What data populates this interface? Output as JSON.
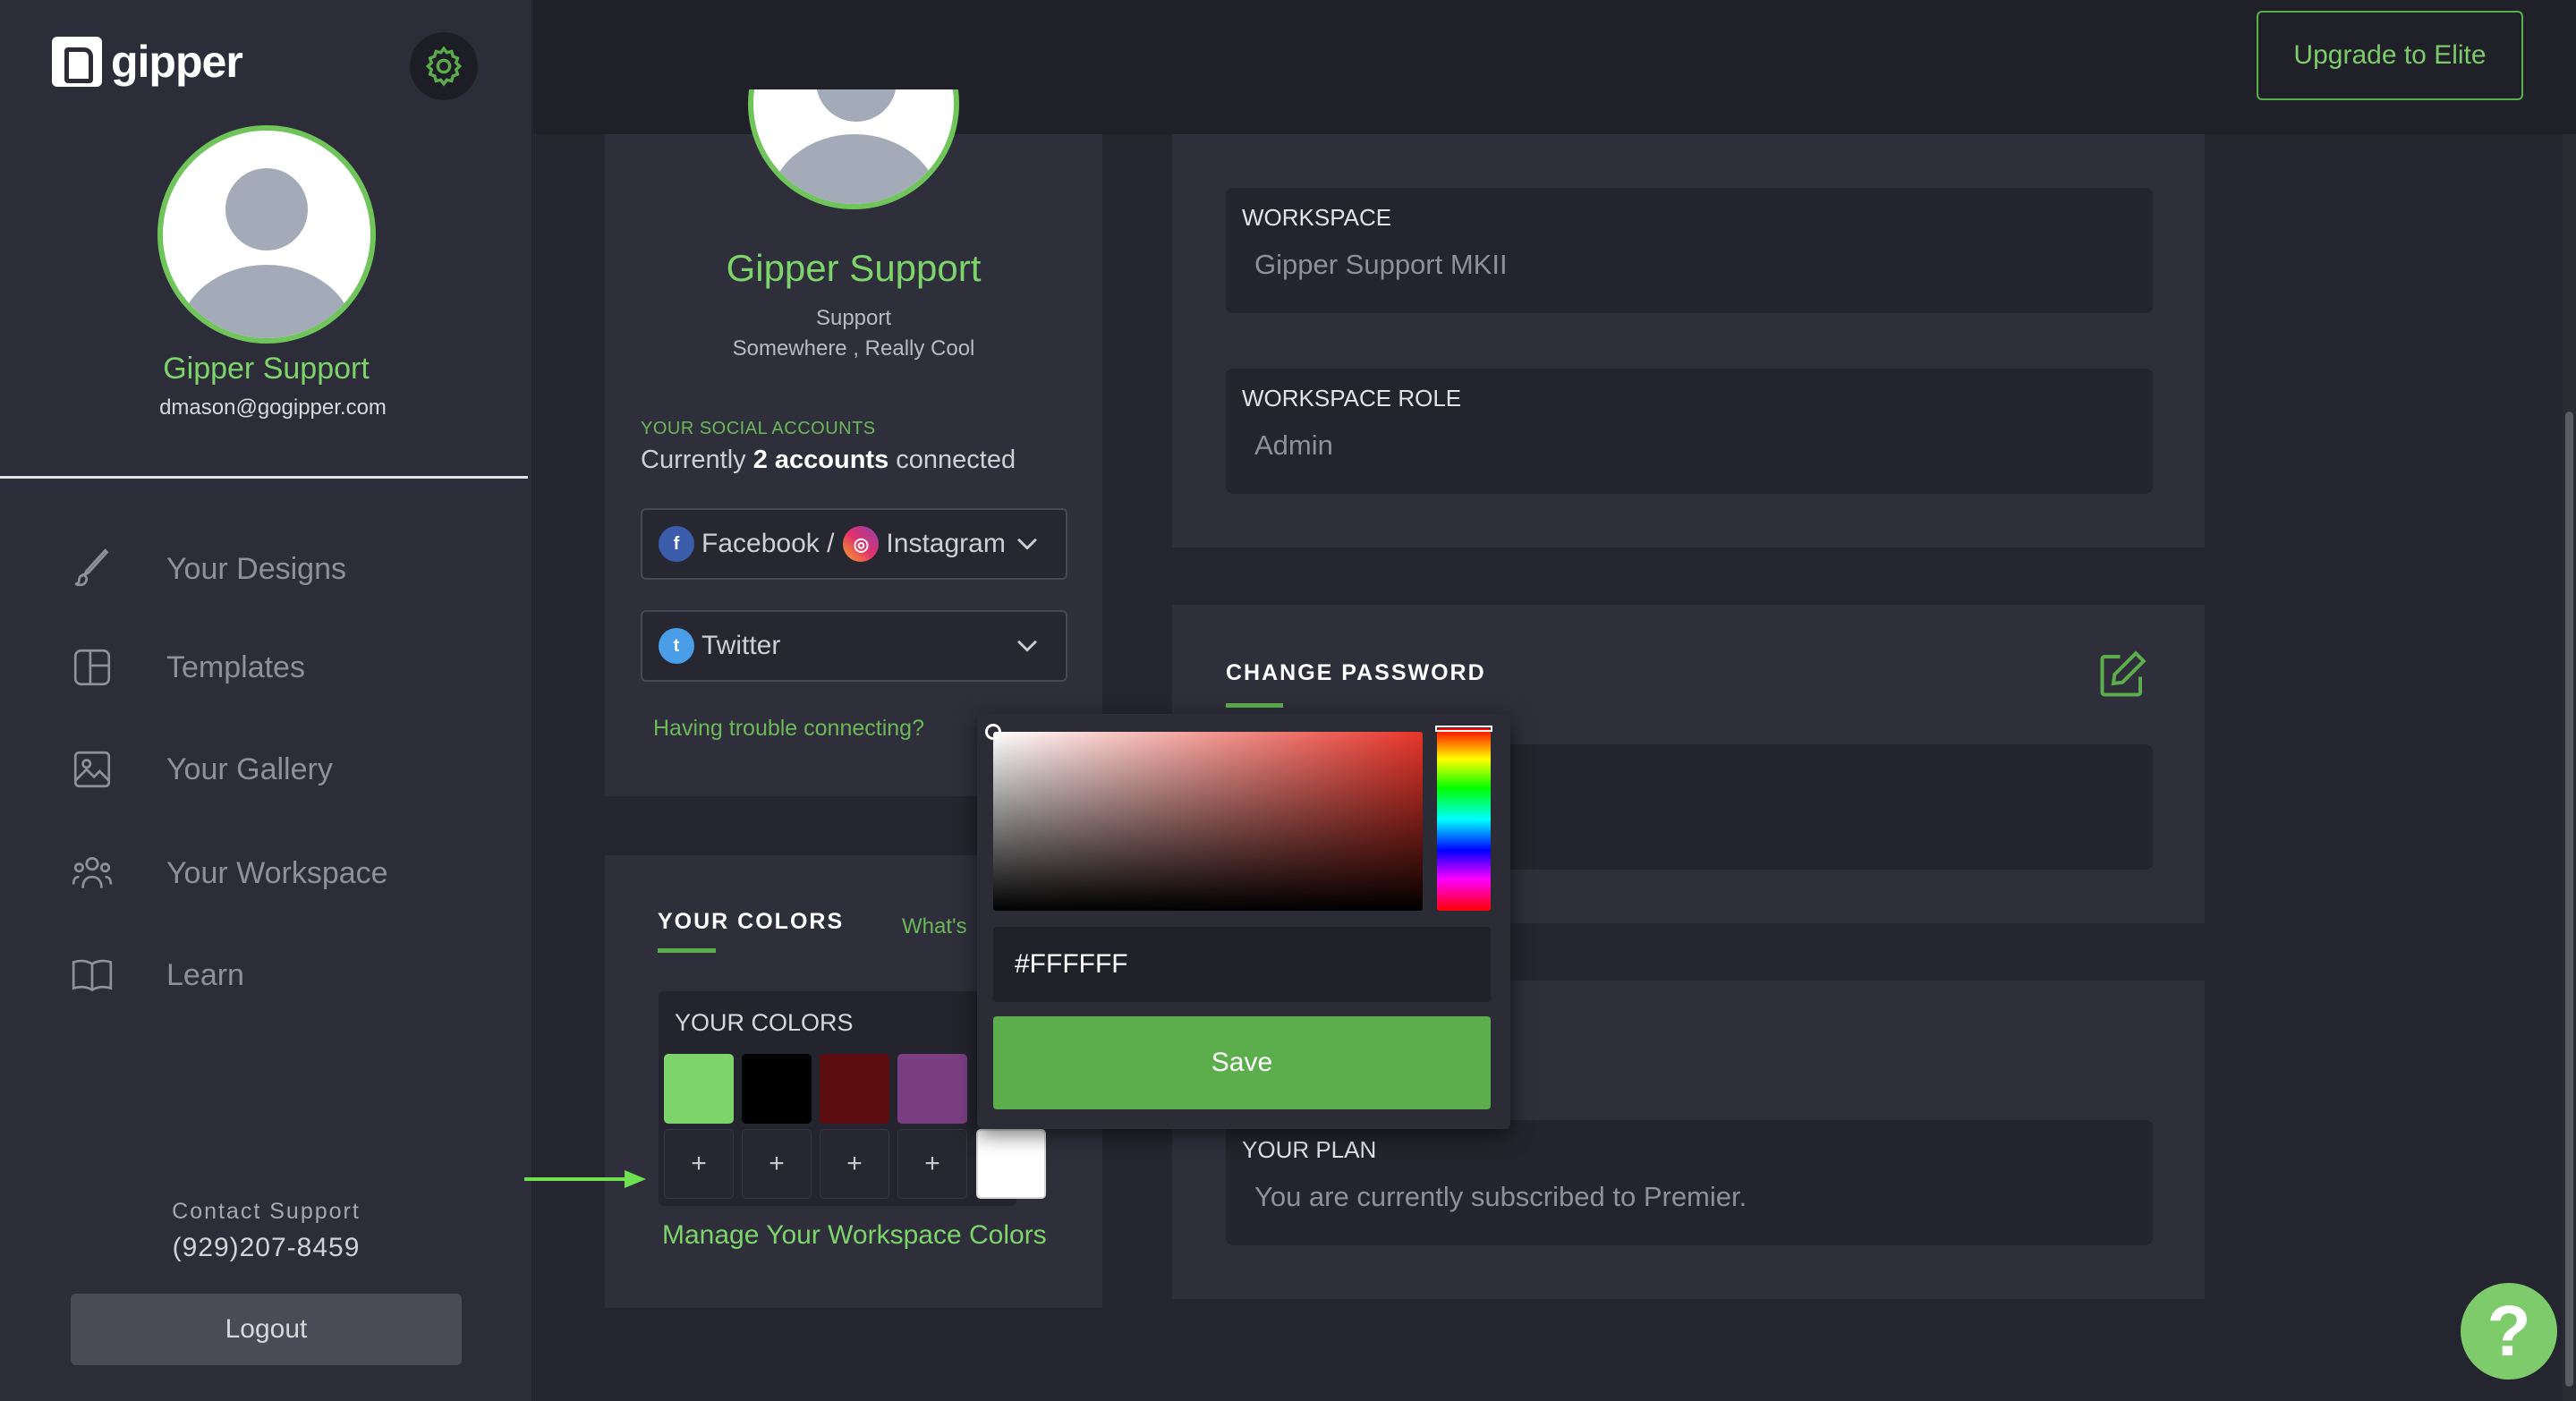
{
  "brand": {
    "name": "gipper",
    "accent": "#5cae4c",
    "accent_light": "#7dd46a"
  },
  "sidebar": {
    "user_name": "Gipper Support",
    "user_email": "dmason@gogipper.com",
    "nav": [
      {
        "label": "Your Designs",
        "icon": "brush-icon"
      },
      {
        "label": "Templates",
        "icon": "templates-icon"
      },
      {
        "label": "Your Gallery",
        "icon": "gallery-icon"
      },
      {
        "label": "Your Workspace",
        "icon": "workspace-icon"
      },
      {
        "label": "Learn",
        "icon": "book-icon"
      }
    ],
    "contact_label": "Contact Support",
    "contact_phone": "(929)207-8459",
    "logout_label": "Logout"
  },
  "header": {
    "upgrade_label": "Upgrade to Elite"
  },
  "profile": {
    "name": "Gipper Support",
    "role": "Support",
    "location": "Somewhere , Really Cool",
    "social_label": "YOUR SOCIAL ACCOUNTS",
    "social_prefix": "Currently",
    "social_count": "2 accounts",
    "social_suffix": "connected",
    "accounts": [
      {
        "label_a": "Facebook /",
        "label_b": "Instagram"
      },
      {
        "label_a": "Twitter"
      }
    ],
    "trouble_link": "Having trouble connecting?"
  },
  "colors": {
    "tab_label": "YOUR COLORS",
    "whats_link": "What's",
    "palette_title": "YOUR COLORS",
    "swatches": [
      "#7dd46a",
      "#000000",
      "#5c0d0f",
      "#7a3f80"
    ],
    "plus_label": "+",
    "selected_swatch": "#FFFFFF",
    "manage_link": "Manage Your Workspace Colors"
  },
  "workspace": {
    "workspace_label": "WORKSPACE",
    "workspace_value": "Gipper Support MKII",
    "role_label": "WORKSPACE ROLE",
    "role_value": "Admin"
  },
  "password": {
    "title": "CHANGE PASSWORD"
  },
  "plan": {
    "label": "YOUR PLAN",
    "value": "You are currently subscribed to Premier."
  },
  "picker": {
    "hex_value": "#FFFFFF",
    "save_label": "Save"
  },
  "help_label": "?"
}
